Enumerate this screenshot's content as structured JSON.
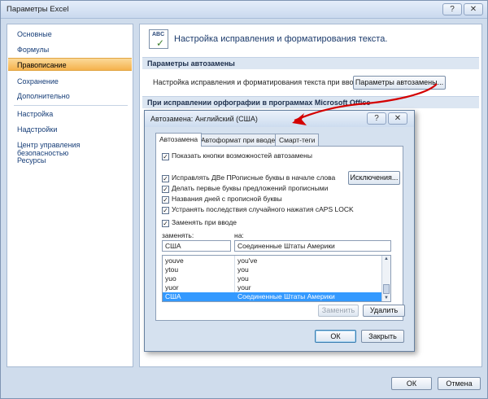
{
  "window": {
    "title": "Параметры Excel",
    "help_button": "?",
    "close_button": "✕"
  },
  "sidebar": {
    "items": [
      {
        "label": "Основные",
        "active": false
      },
      {
        "label": "Формулы",
        "active": false
      },
      {
        "label": "Правописание",
        "active": true
      },
      {
        "label": "Сохранение",
        "active": false
      },
      {
        "label": "Дополнительно",
        "active": false
      },
      {
        "label": "Настройка",
        "active": false
      },
      {
        "label": "Надстройки",
        "active": false
      },
      {
        "label": "Центр управления безопасностью",
        "active": false
      },
      {
        "label": "Ресурсы",
        "active": false
      }
    ]
  },
  "content": {
    "header_title": "Настройка исправления и форматирования текста.",
    "header_icon_text": "ABC",
    "header_icon_check": "✓",
    "section_autocorrect": "Параметры автозамены",
    "autocorrect_text": "Настройка исправления и форматирования текста при вводе:",
    "autocorrect_button": "Параметры автозамены...",
    "section_spelling": "При исправлении орфографии в программах Microsoft Office"
  },
  "dialog": {
    "title": "Автозамена: Английский (США)",
    "help_button": "?",
    "close_button": "✕",
    "tabs": [
      {
        "label": "Автозамена",
        "active": true
      },
      {
        "label": "Автоформат при вводе",
        "active": false
      },
      {
        "label": "Смарт-теги",
        "active": false
      }
    ],
    "check_show_buttons": "Показать кнопки возможностей автозамены",
    "check_two_caps": "Исправлять ДВе ПРописные буквы в начале слова",
    "check_first_letter": "Делать первые буквы предложений прописными",
    "check_day_names": "Названия дней с прописной буквы",
    "check_caps_lock": "Устранять последствия случайного нажатия cAPS LOCK",
    "check_replace": "Заменять при вводе",
    "checkmark": "✓",
    "exceptions_button": "Исключения...",
    "replace_label": "заменять:",
    "with_label": "на:",
    "replace_value": "США",
    "with_value": "Соединенные Штаты Америки",
    "entries": [
      {
        "from": "youve",
        "to": "you've",
        "selected": false
      },
      {
        "from": "ytou",
        "to": "you",
        "selected": false
      },
      {
        "from": "yuo",
        "to": "you",
        "selected": false
      },
      {
        "from": "yuor",
        "to": "your",
        "selected": false
      },
      {
        "from": "США",
        "to": "Соединенные Штаты Америки",
        "selected": true
      }
    ],
    "replace_button": "Заменить",
    "delete_button": "Удалить",
    "ok_button": "ОК",
    "close_dialog_button": "Закрыть"
  },
  "footer": {
    "ok_button": "ОК",
    "cancel_button": "Отмена"
  },
  "colors": {
    "active_nav": "#f5b24d",
    "selection": "#3399ff",
    "annotation_arrow": "#d40000"
  }
}
